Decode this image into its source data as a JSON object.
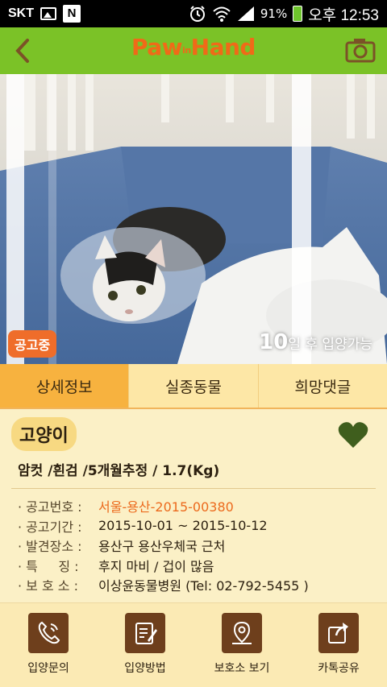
{
  "status_bar": {
    "carrier": "SKT",
    "n_badge": "N",
    "battery": "91%",
    "time": "오후 12:53"
  },
  "header": {
    "logo_text": "Paw",
    "logo_in": "in",
    "logo_text2": "Hand"
  },
  "hero": {
    "badge": "공고중",
    "days": "10",
    "adopt_text": "일 후 입양가능"
  },
  "tabs": [
    {
      "label": "상세정보",
      "active": true
    },
    {
      "label": "실종동물",
      "active": false
    },
    {
      "label": "희망댓글",
      "active": false
    }
  ],
  "detail": {
    "species": "고양이",
    "summary": "암컷 /흰검 /5개월추정 / 1.7(Kg)",
    "rows": [
      {
        "label": "· 공고번호 :",
        "value": "서울-용산-2015-00380"
      },
      {
        "label": "· 공고기간 :",
        "value": "2015-10-01 ~ 2015-10-12"
      },
      {
        "label": "· 발견장소 :",
        "value": "용산구 용산우체국 근처"
      },
      {
        "label": "· 특     징 :",
        "value": "후지 마비 / 겁이 많음"
      },
      {
        "label": "· 보 호 소 :",
        "value": "이상윤동물병원 (Tel: 02-792-5455 )"
      }
    ]
  },
  "bottom": [
    {
      "label": "입양문의",
      "icon": "phone-icon"
    },
    {
      "label": "입양방법",
      "icon": "note-icon"
    },
    {
      "label": "보호소 보기",
      "icon": "map-pin-icon"
    },
    {
      "label": "카톡공유",
      "icon": "share-icon"
    }
  ],
  "colors": {
    "green": "#7bc227",
    "orange": "#ef6d2a",
    "brown": "#6e3f1c",
    "heart": "#3f5e1d"
  }
}
